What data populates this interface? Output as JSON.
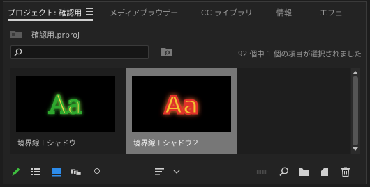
{
  "tabs": [
    {
      "label": "プロジェクト: 確認用"
    },
    {
      "label": "メディアブラウザー"
    },
    {
      "label": "CC ライブラリ"
    },
    {
      "label": "情報"
    },
    {
      "label": "エフェ"
    }
  ],
  "bin": {
    "name": "確認用.prproj"
  },
  "search": {
    "value": "",
    "placeholder": ""
  },
  "status_text": "92 個中 1 個の項目が選択されました",
  "items": [
    {
      "label": "境界線＋シャドウ",
      "thumb_text": "Aa",
      "selected": false
    },
    {
      "label": "境界線＋シャドウ２",
      "thumb_text": "Aa",
      "selected": true
    }
  ],
  "icons": {
    "pencil": "pencil-icon",
    "list_view": "list-view-icon",
    "icon_view": "icon-view-icon",
    "freeform_view": "freeform-view-icon",
    "sort": "sort-icon",
    "automate": "automate-to-sequence-icon",
    "find": "search-icon",
    "new_bin": "new-bin-icon",
    "new_item": "new-item-icon",
    "delete": "trash-icon"
  },
  "colors": {
    "accent_blue": "#2d8ceb",
    "pencil_green": "#3fbf3f",
    "selection": "#777777"
  }
}
